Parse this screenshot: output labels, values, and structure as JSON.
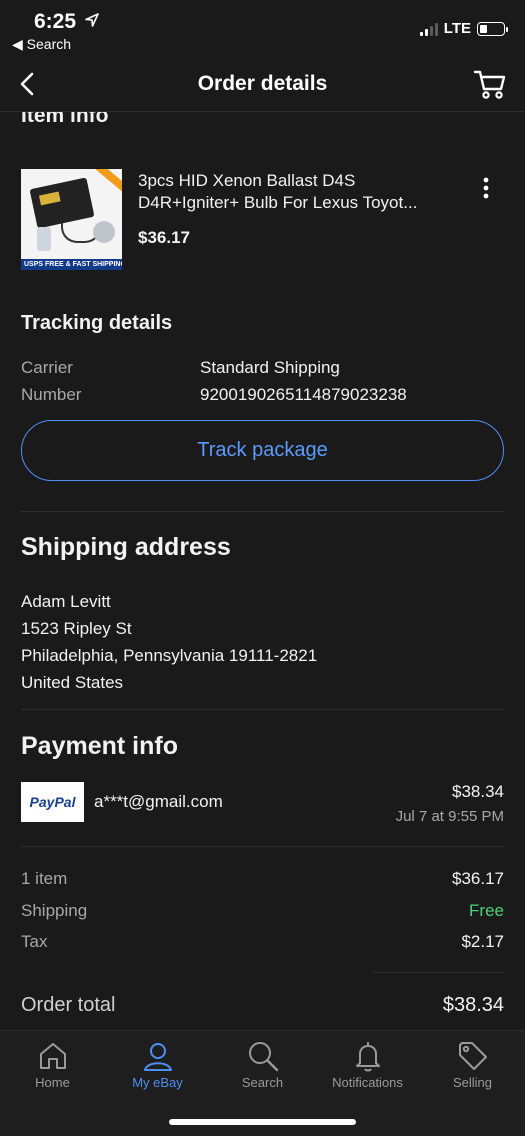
{
  "status_bar": {
    "time": "6:25",
    "back_label": "◀ Search",
    "network": "LTE"
  },
  "header": {
    "title": "Order details"
  },
  "item_info": {
    "section_title": "Item info",
    "title_line1": "3pcs HID Xenon Ballast D4S",
    "title_line2": "D4R+Igniter+ Bulb For Lexus Toyot...",
    "price": "$36.17",
    "image_banner": "USPS FREE & FAST SHIPPING"
  },
  "tracking": {
    "section_title": "Tracking details",
    "carrier_label": "Carrier",
    "carrier_value": "Standard Shipping",
    "number_label": "Number",
    "number_value": "9200190265114879023238",
    "track_button": "Track package"
  },
  "shipping_address": {
    "section_title": "Shipping address",
    "lines": [
      "Adam Levitt",
      "1523 Ripley St",
      "Philadelphia, Pennsylvania 19111-2821",
      "United States"
    ]
  },
  "payment": {
    "section_title": "Payment info",
    "method_logo": "PayPal",
    "email": "a***t@gmail.com",
    "amount": "$38.34",
    "date": "Jul 7 at 9:55 PM"
  },
  "summary": {
    "items_label": "1 item",
    "items_value": "$36.17",
    "shipping_label": "Shipping",
    "shipping_value": "Free",
    "tax_label": "Tax",
    "tax_value": "$2.17",
    "total_label": "Order total",
    "total_value": "$38.34"
  },
  "tabs": [
    {
      "label": "Home",
      "icon": "home-icon",
      "active": false
    },
    {
      "label": "My eBay",
      "icon": "user-icon",
      "active": true
    },
    {
      "label": "Search",
      "icon": "search-icon",
      "active": false
    },
    {
      "label": "Notifications",
      "icon": "bell-icon",
      "active": false
    },
    {
      "label": "Selling",
      "icon": "tag-icon",
      "active": false
    }
  ],
  "colors": {
    "background": "#1a1a1a",
    "accent": "#4f8ef7",
    "free": "#4ed07a"
  }
}
